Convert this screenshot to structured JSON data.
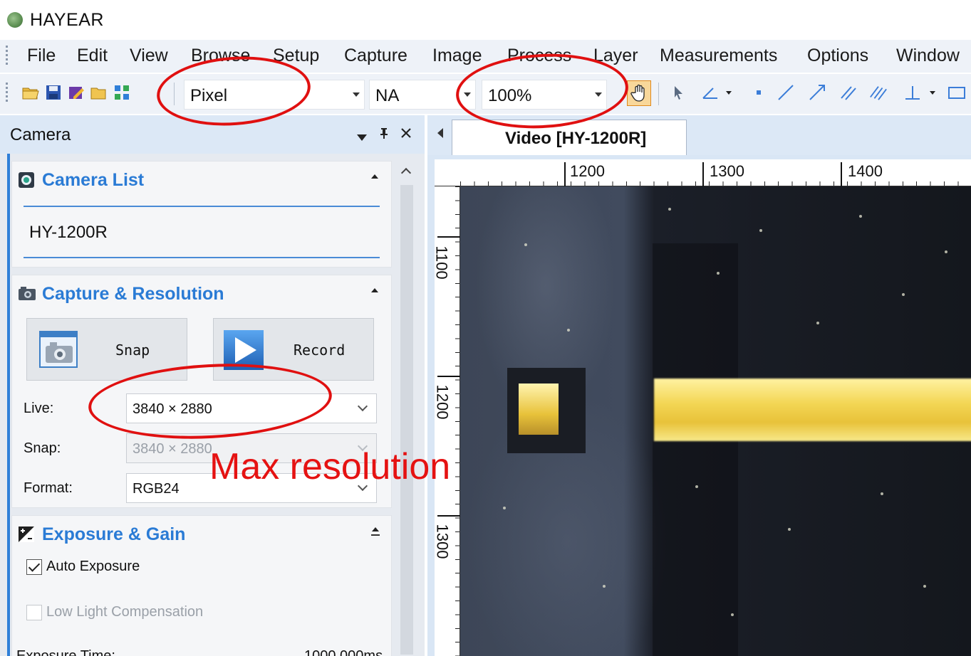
{
  "app": {
    "title": "HAYEAR"
  },
  "menu": [
    "File",
    "Edit",
    "View",
    "Browse",
    "Setup",
    "Capture",
    "Image",
    "Process",
    "Layer",
    "Measurements",
    "Options",
    "Window"
  ],
  "toolbar": {
    "unit_combo": "Pixel",
    "objective_combo": "NA",
    "zoom_combo": "100%"
  },
  "camera_panel": {
    "title": "Camera",
    "camera_list": {
      "title": "Camera List",
      "items": [
        "HY-1200R"
      ]
    },
    "capture": {
      "title": "Capture & Resolution",
      "snap_label": "Snap",
      "record_label": "Record",
      "live_label": "Live:",
      "live_value": "3840 × 2880",
      "snap_res_label": "Snap:",
      "snap_res_value": "3840 × 2880",
      "format_label": "Format:",
      "format_value": "RGB24"
    },
    "exposure": {
      "title": "Exposure & Gain",
      "auto_exposure_label": "Auto Exposure",
      "auto_exposure_checked": true,
      "low_light_label": "Low Light Compensation",
      "exposure_time_label": "Exposure Time:",
      "exposure_time_value": "1000.000ms"
    }
  },
  "video": {
    "tab_label": "Video [HY-1200R]",
    "ruler_top": [
      "1200",
      "1300",
      "1400"
    ],
    "ruler_left": [
      "1100",
      "1200",
      "1300"
    ]
  },
  "annotation": {
    "text": "Max resolution",
    "color": "#e51212"
  },
  "colors": {
    "accent": "#2a7bd5",
    "panel": "#dce8f6",
    "annotation": "#e01010"
  }
}
